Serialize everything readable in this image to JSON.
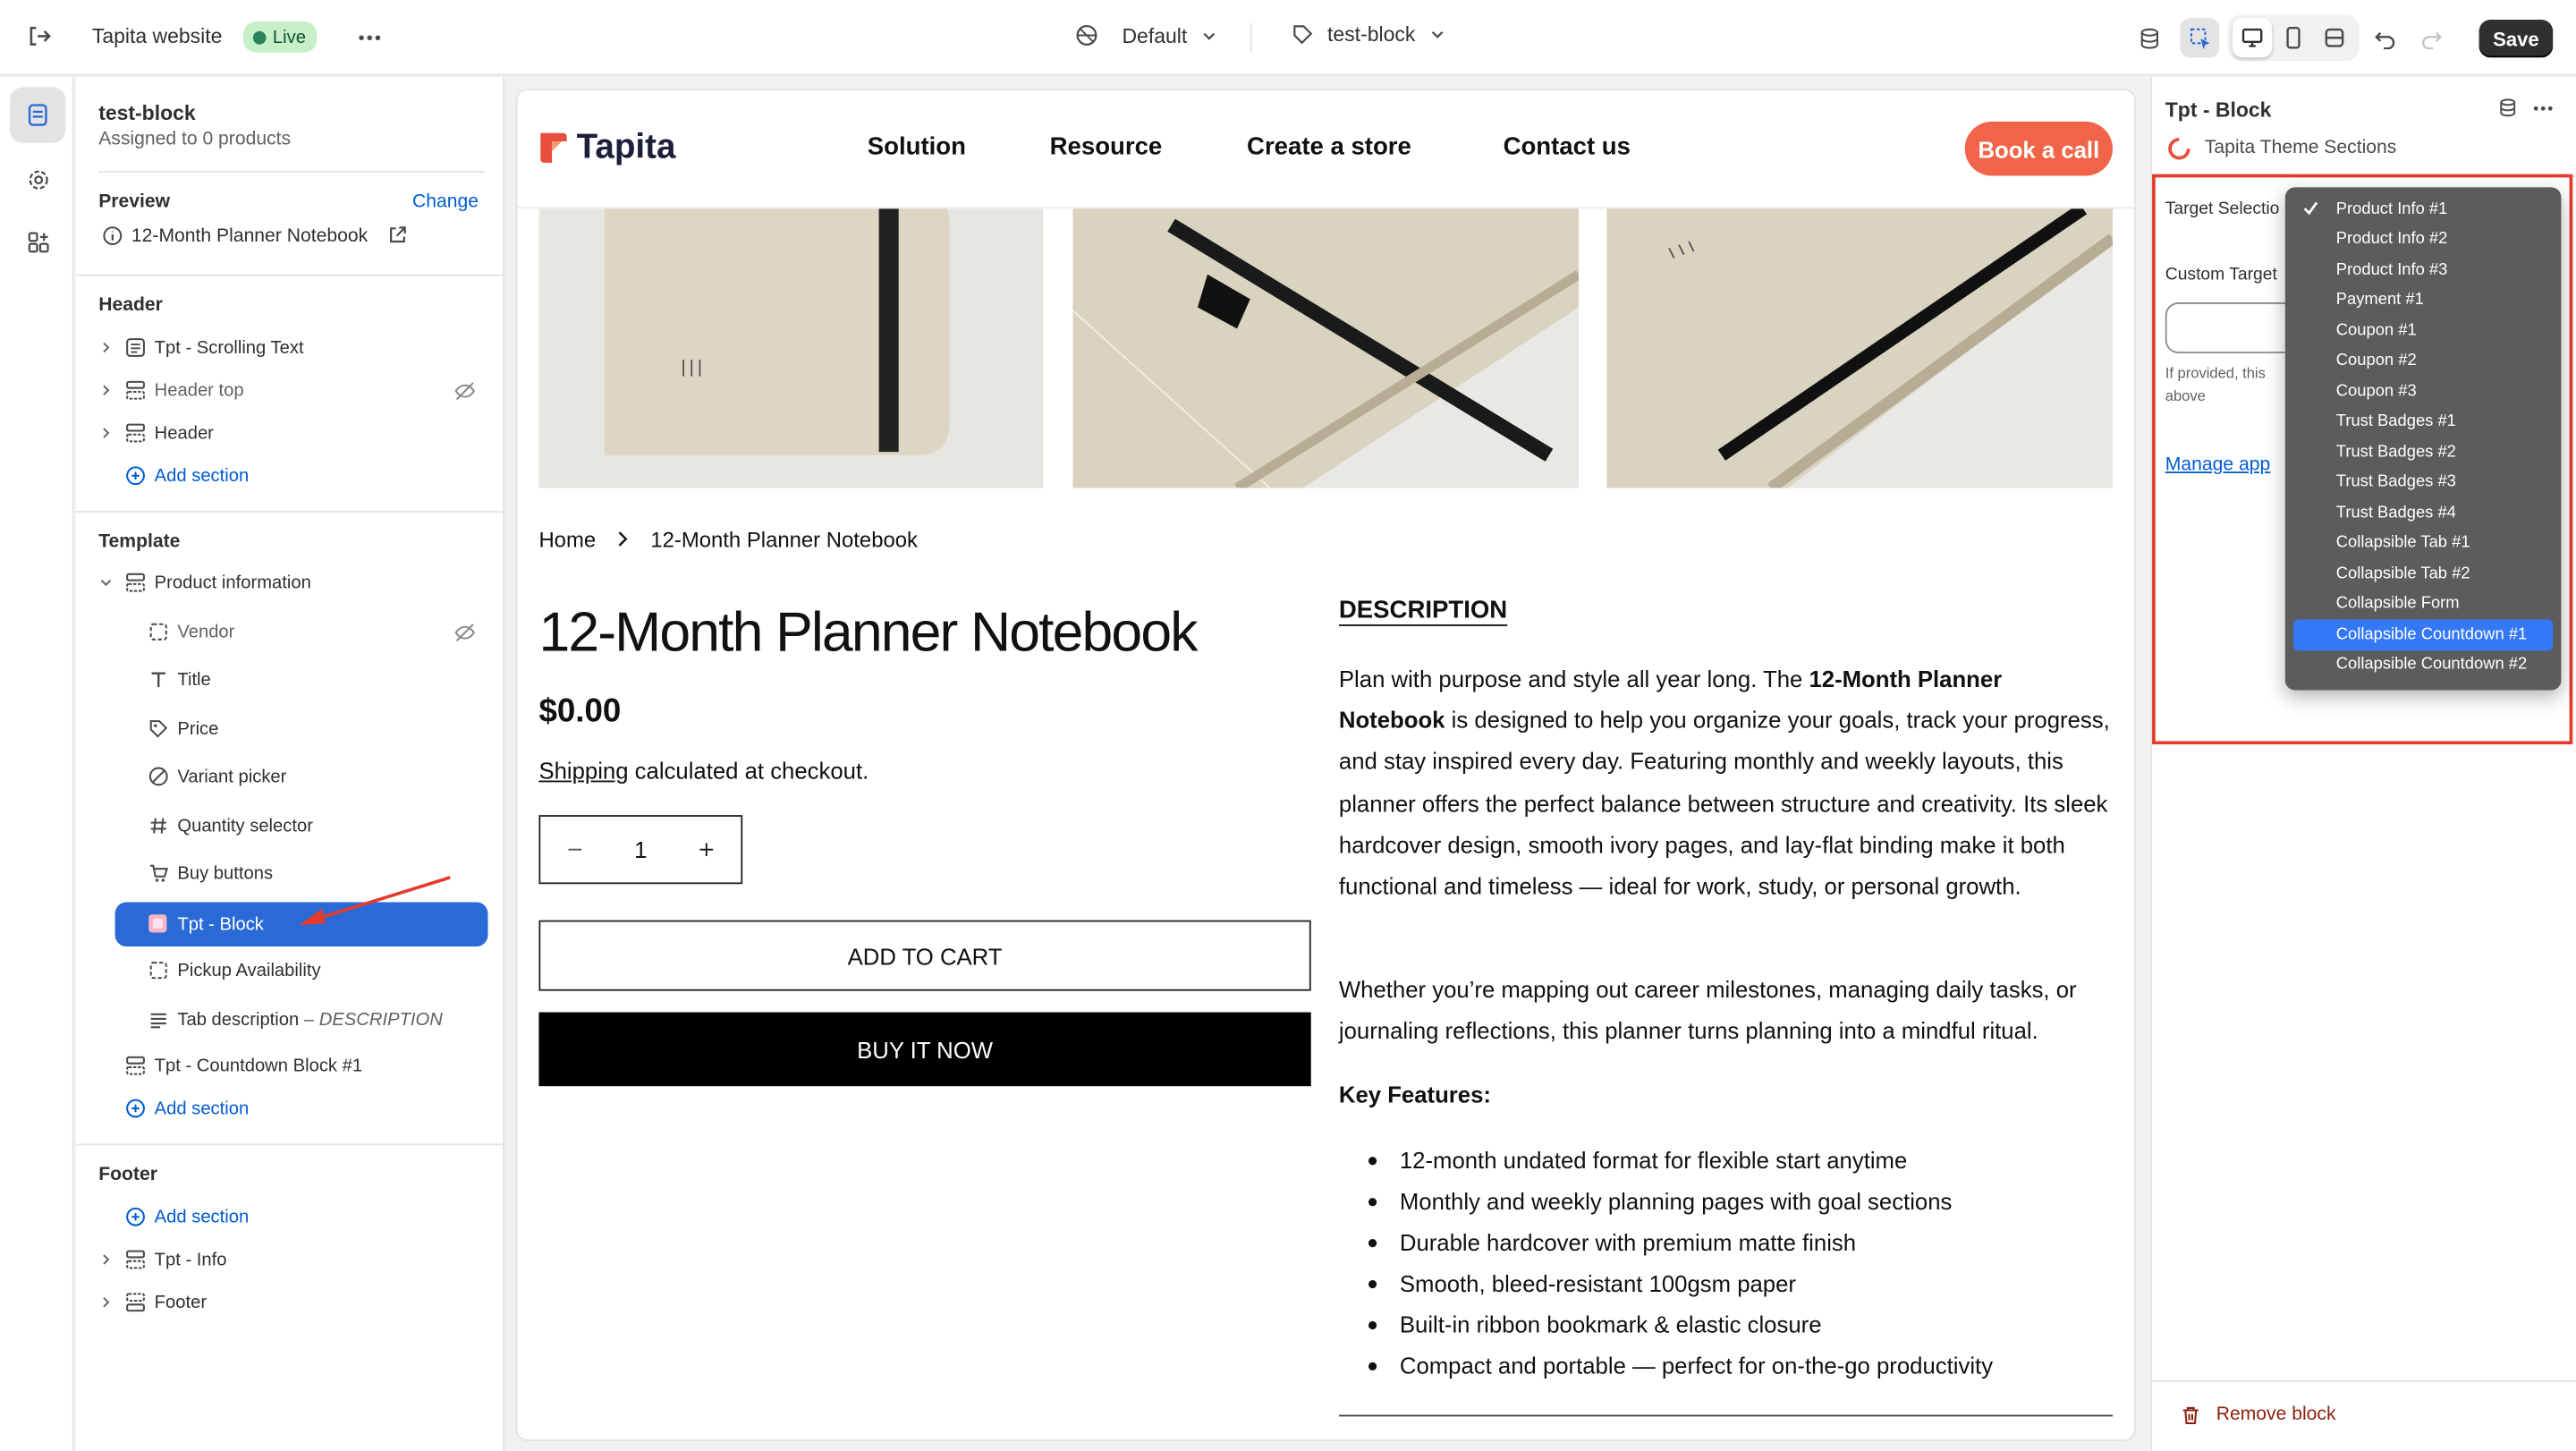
{
  "topbar": {
    "store_name": "Tapita website",
    "status_badge": "Live",
    "theme_selector": "Default",
    "template_selector": "test-block",
    "save_label": "Save"
  },
  "sidebar": {
    "template_name": "test-block",
    "assigned": "Assigned to 0 products",
    "preview_label": "Preview",
    "preview_change": "Change",
    "preview_product": "12-Month Planner Notebook",
    "header_group": {
      "title": "Header",
      "items": [
        "Tpt - Scrolling Text",
        "Header top",
        "Header"
      ],
      "add_section": "Add section"
    },
    "template_group": {
      "title": "Template",
      "section": "Product information",
      "blocks": [
        "Vendor",
        "Title",
        "Price",
        "Variant picker",
        "Quantity selector",
        "Buy buttons",
        "Tpt - Block",
        "Pickup Availability",
        "Tab description"
      ],
      "tab_description_suffix": "– DESCRIPTION",
      "countdown": "Tpt - Countdown Block #1",
      "add_section": "Add section"
    },
    "footer_group": {
      "title": "Footer",
      "add_section": "Add section",
      "items": [
        "Tpt - Info",
        "Footer"
      ]
    }
  },
  "store": {
    "logo_text": "Tapita",
    "nav": [
      "Solution",
      "Resource",
      "Create a store",
      "Contact us"
    ],
    "cta": "Book a call",
    "breadcrumb_home": "Home",
    "breadcrumb_current": "12-Month Planner Notebook",
    "product_title": "12-Month Planner Notebook",
    "price": "$0.00",
    "shipping_link": "Shipping",
    "shipping_rest": "calculated at checkout.",
    "quantity": "1",
    "add_to_cart": "ADD TO CART",
    "buy_now": "BUY IT NOW",
    "description_heading": "DESCRIPTION",
    "desc_p1_a": "Plan with purpose and style all year long. The ",
    "desc_p1_b": "12-Month Planner Notebook",
    "desc_p1_c": " is designed to help you organize your goals, track your progress, and stay inspired every day. Featuring monthly and weekly layouts, this planner offers the perfect balance between structure and creativity. Its sleek hardcover design, smooth ivory pages, and lay-flat binding make it both functional and timeless — ideal for work, study, or personal growth.",
    "desc_p2": "Whether you’re mapping out career milestones, managing daily tasks, or journaling reflections, this planner turns planning into a mindful ritual.",
    "key_features_heading": "Key Features:",
    "features": [
      "12-month undated format for flexible start anytime",
      "Monthly and weekly planning pages with goal sections",
      "Durable hardcover with premium matte finish",
      "Smooth, bleed-resistant 100gsm paper",
      "Built-in ribbon bookmark & elastic closure",
      "Compact and portable — perfect for on-the-go productivity"
    ]
  },
  "panel": {
    "title": "Tpt - Block",
    "app_name": "Tapita Theme Sections",
    "target_selection_label": "Target Selectio",
    "custom_target_label": "Custom Target",
    "help_text_1": "If provided, this",
    "help_text_2": "above",
    "manage_app": "Manage app",
    "remove_block": "Remove block",
    "dropdown_options": [
      "Product Info #1",
      "Product Info #2",
      "Product Info #3",
      "Payment #1",
      "Coupon #1",
      "Coupon #2",
      "Coupon #3",
      "Trust Badges #1",
      "Trust Badges #2",
      "Trust Badges #3",
      "Trust Badges #4",
      "Collapsible Tab #1",
      "Collapsible Tab #2",
      "Collapsible Form",
      "Collapsible Countdown #1",
      "Collapsible Countdown #2"
    ],
    "checked_option": "Product Info #1",
    "highlighted_option": "Collapsible Countdown #1"
  },
  "colors": {
    "accent": "#2a6ad6",
    "cta": "#f06449",
    "annotation_red": "#e33b2e",
    "link_blue": "#005bd3"
  }
}
